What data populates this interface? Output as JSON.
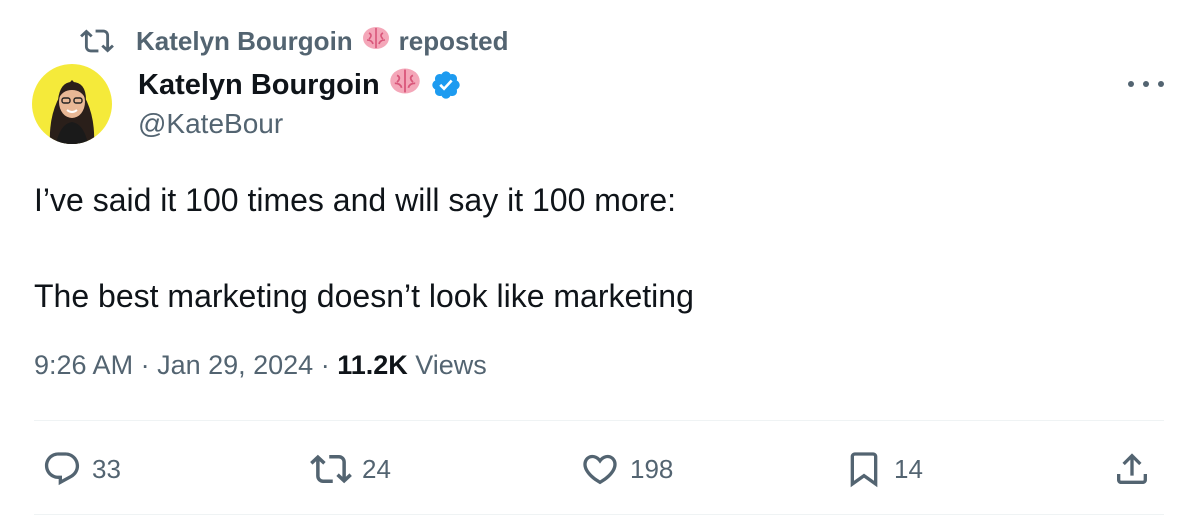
{
  "repost_banner": {
    "name": "Katelyn Bourgoin",
    "emoji": "🧠",
    "action": "reposted"
  },
  "author": {
    "display_name": "Katelyn Bourgoin",
    "emoji": "🧠",
    "handle": "@KateBour",
    "verified": true,
    "verified_color": "#1d9bf0",
    "avatar_background": "#f5ea3a"
  },
  "tweet": {
    "text": "I’ve said it 100 times and will say it 100 more:\n\nThe best marketing doesn’t look like marketing"
  },
  "meta": {
    "time": "9:26 AM",
    "sep1": " · ",
    "date": "Jan 29, 2024",
    "sep2": " · ",
    "views_count": "11.2K",
    "views_label": " Views"
  },
  "actions": {
    "replies": "33",
    "reposts": "24",
    "likes": "198",
    "bookmarks": "14"
  },
  "icons": {
    "repost": "repost-icon",
    "reply": "reply-icon",
    "like": "heart-icon",
    "bookmark": "bookmark-icon",
    "share": "share-icon",
    "more": "more-icon",
    "verified": "verified-badge-icon",
    "brain": "brain-emoji"
  },
  "colors": {
    "secondary_text": "#536471",
    "primary_text": "#0f1419",
    "divider": "#eff3f4"
  }
}
